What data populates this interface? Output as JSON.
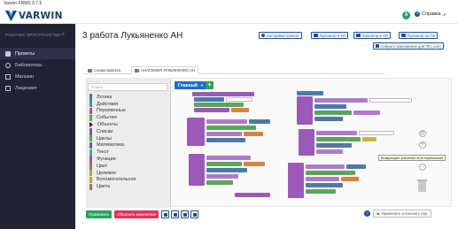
{
  "window": {
    "title": "Varwin XRMS 0.7.5"
  },
  "header": {
    "logo_text": "VARWIN",
    "user_initial": "A",
    "help_label": "Справка"
  },
  "sidebar": {
    "heading": "РАБОЧЕЕ ПРОСТРАНСТВО",
    "items": [
      {
        "label": "Проекты",
        "icon": "folder-icon",
        "active": true
      },
      {
        "label": "Библиотека",
        "icon": "gear-icon",
        "active": false
      },
      {
        "label": "Магазин",
        "icon": "store-icon",
        "active": false
      },
      {
        "label": "Лицензия",
        "icon": "license-icon",
        "active": false
      }
    ]
  },
  "page": {
    "title": "3 работа Лукьяненко АН"
  },
  "toolbar": {
    "settings": "Настройки проекта",
    "view_vr": "Просмотр в VR",
    "view_ar": "Просмотр в AR",
    "view_pc": "Просмотр на ПК",
    "build_pc": "Собрать приложение для ПК (.exe)"
  },
  "tabs": [
    {
      "label": "Схема проекта",
      "active": false
    },
    {
      "label": "АНАТОМИЯ ЛУКЬЯНЕНКО АН",
      "active": true
    }
  ],
  "logic": {
    "search_placeholder": "Поиск",
    "main_button": "Главный",
    "categories": [
      {
        "label": "Логика",
        "color": "#4e79a7"
      },
      {
        "label": "Действия",
        "color": "#5b80a5"
      },
      {
        "label": "Переменные",
        "color": "#a55b80"
      },
      {
        "label": "События",
        "color": "#5ba55b"
      },
      {
        "label": "Объекты",
        "color": "#8c5ba5",
        "expandable": true
      },
      {
        "label": "Списки",
        "color": "#745ba5"
      },
      {
        "label": "Циклы",
        "color": "#5ba55b"
      },
      {
        "label": "Математика",
        "color": "#5b67a5"
      },
      {
        "label": "Текст",
        "color": "#5ba58c"
      },
      {
        "label": "Функции",
        "color": "#995ba5"
      },
      {
        "label": "Цвет",
        "color": "#a5745b"
      },
      {
        "label": "Целевое",
        "color": "#a5a55b"
      },
      {
        "label": "Вспомогательное",
        "color": "#c0a040"
      },
      {
        "label": "Цвета",
        "color": "#a5745b"
      }
    ],
    "tooltip": "Возвращает значение этой переменной"
  },
  "bottom": {
    "apply": "Применить",
    "reset": "Сбросить изменения",
    "show_btn": "Применить и показать под."
  },
  "colors": {
    "accent": "#1d4f91",
    "sidebar_bg": "#1f2333",
    "apply": "#2aa35a",
    "reset": "#e0345a"
  }
}
